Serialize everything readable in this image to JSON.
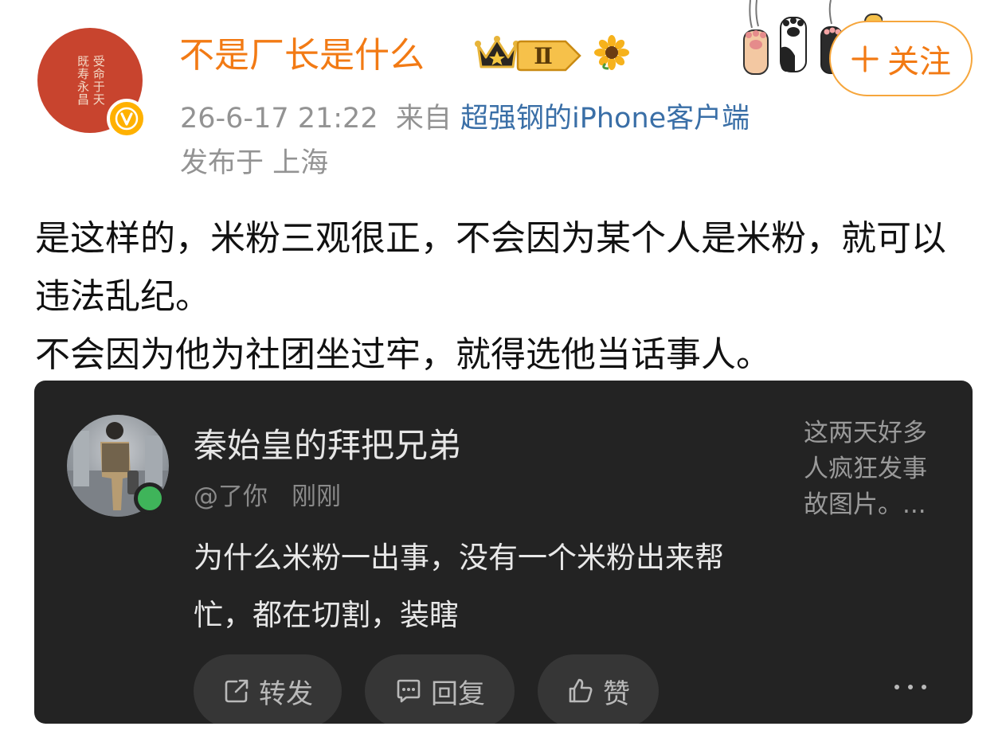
{
  "author": {
    "name": "不是厂长是什么",
    "avatar_seal_lines": [
      "受命于天",
      "既寿永昌"
    ],
    "verified_badge": "v-icon",
    "level": "Ⅱ"
  },
  "follow_button": {
    "label": "关注",
    "icon": "plus-icon"
  },
  "meta": {
    "timestamp": "26-6-17 21:22",
    "source_prefix": "来自",
    "source": "超强钢的iPhone客户端",
    "location": "发布于 上海"
  },
  "post": {
    "text": "是这样的，米粉三观很正，不会因为某个人是米粉，就可以违法乱纪。\n不会因为他为社团坐过牢，就得选他当话事人。"
  },
  "quoted_card": {
    "name": "秦始皇的拜把兄弟",
    "handle": "@了你",
    "time": "刚刚",
    "side_text": "这两天好多人疯狂发事故图片。...",
    "body": "为什么米粉一出事，没有一个米粉出来帮忙，都在切割，装瞎",
    "actions": {
      "repost": "转发",
      "comment": "回复",
      "like": "赞"
    }
  },
  "colors": {
    "accent": "#f27a14",
    "follow_border": "#f6a63c",
    "link": "#3a6fa7",
    "meta_gray": "#939393",
    "card_bg": "#232323",
    "online_green": "#3fb45a"
  }
}
